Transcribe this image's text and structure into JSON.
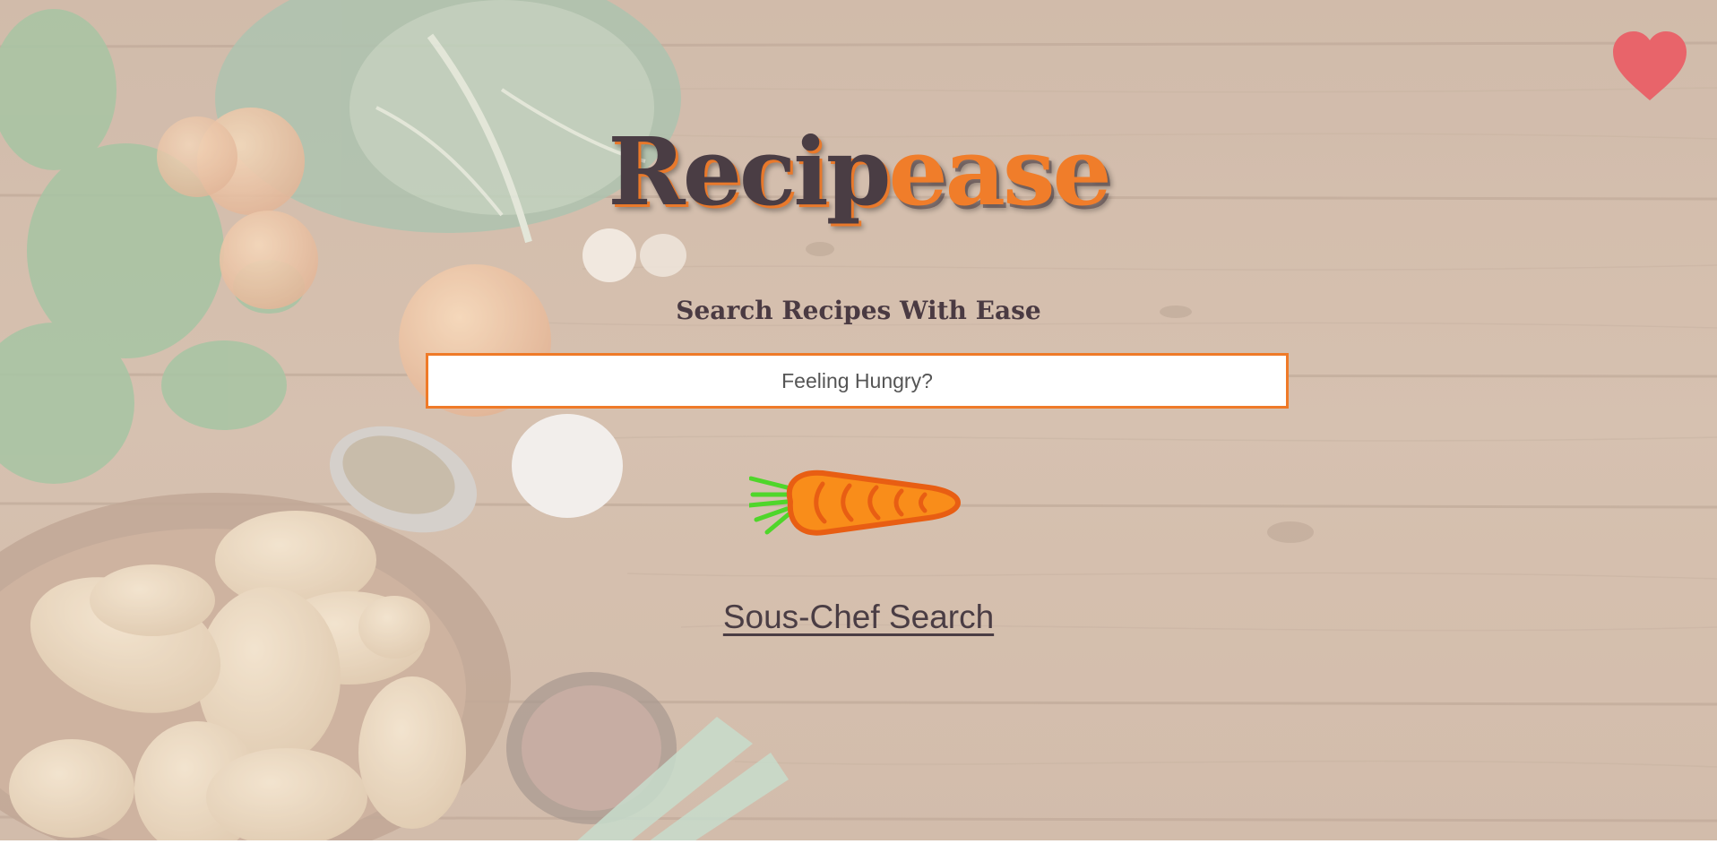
{
  "logo": {
    "part1": "Recip",
    "part2": "ease"
  },
  "tagline": "Search Recipes With Ease",
  "search": {
    "placeholder": "Feeling Hungry?",
    "value": ""
  },
  "links": {
    "sous_chef": "Sous-Chef Search"
  },
  "icons": {
    "favorites": "heart-icon",
    "search_submit": "carrot-icon"
  },
  "colors": {
    "accent_orange": "#ef7a28",
    "dark_plum": "#4a3d44",
    "heart": "#e8646a",
    "background_wood": "#c8ad95"
  }
}
